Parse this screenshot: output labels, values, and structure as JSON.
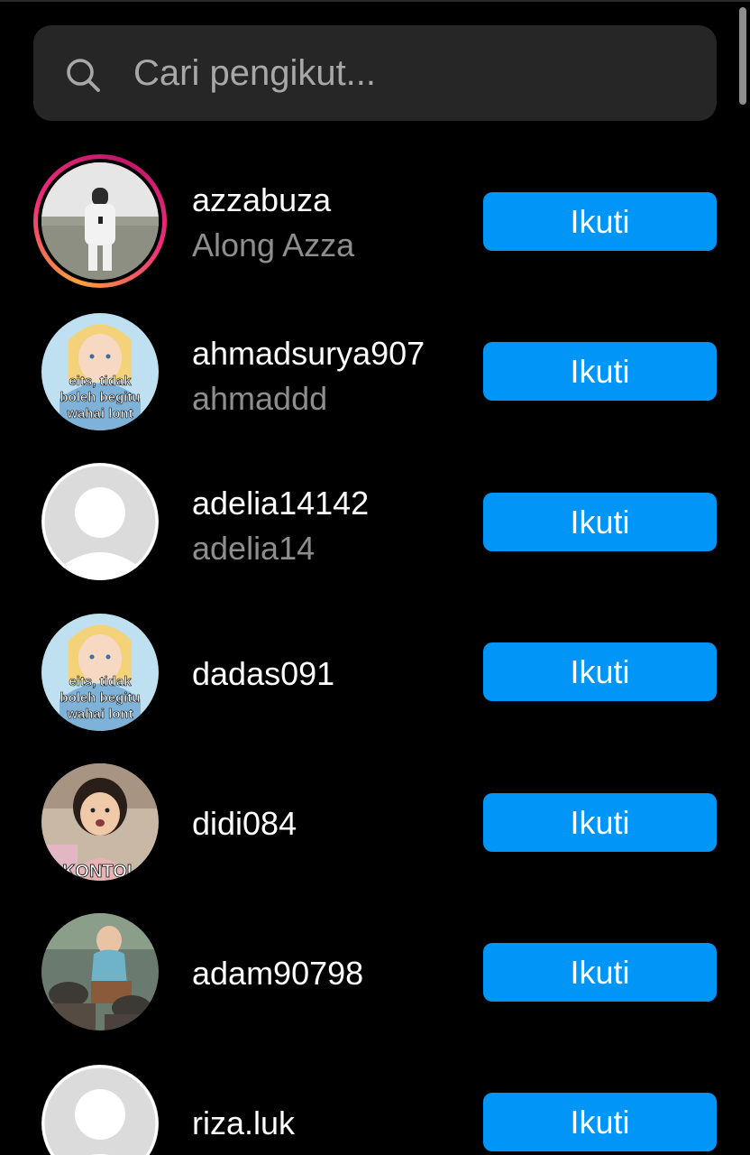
{
  "search": {
    "placeholder": "Cari pengikut...",
    "icon": "search-icon"
  },
  "followers": [
    {
      "username": "azzabuza",
      "fullname": "Along Azza",
      "button": "Ikuti",
      "has_story": true
    },
    {
      "username": "ahmadsurya907",
      "fullname": "ahmaddd",
      "button": "Ikuti",
      "avatar_caption": [
        "eits, tidak",
        "boleh begitu",
        "wahai lont"
      ]
    },
    {
      "username": "adelia14142",
      "fullname": "adelia14",
      "button": "Ikuti"
    },
    {
      "username": "dadas091",
      "fullname": "",
      "button": "Ikuti",
      "avatar_caption": [
        "eits, tidak",
        "boleh begitu",
        "wahai lont"
      ]
    },
    {
      "username": "didi084",
      "fullname": "",
      "button": "Ikuti",
      "avatar_caption": [
        "KONTOL"
      ]
    },
    {
      "username": "adam90798",
      "fullname": "",
      "button": "Ikuti"
    },
    {
      "username": "riza.luk",
      "fullname": "",
      "button": "Ikuti"
    }
  ],
  "colors": {
    "background": "#000000",
    "search_bg": "#262626",
    "button": "#0095f6",
    "secondary_text": "#8e8e8e"
  }
}
